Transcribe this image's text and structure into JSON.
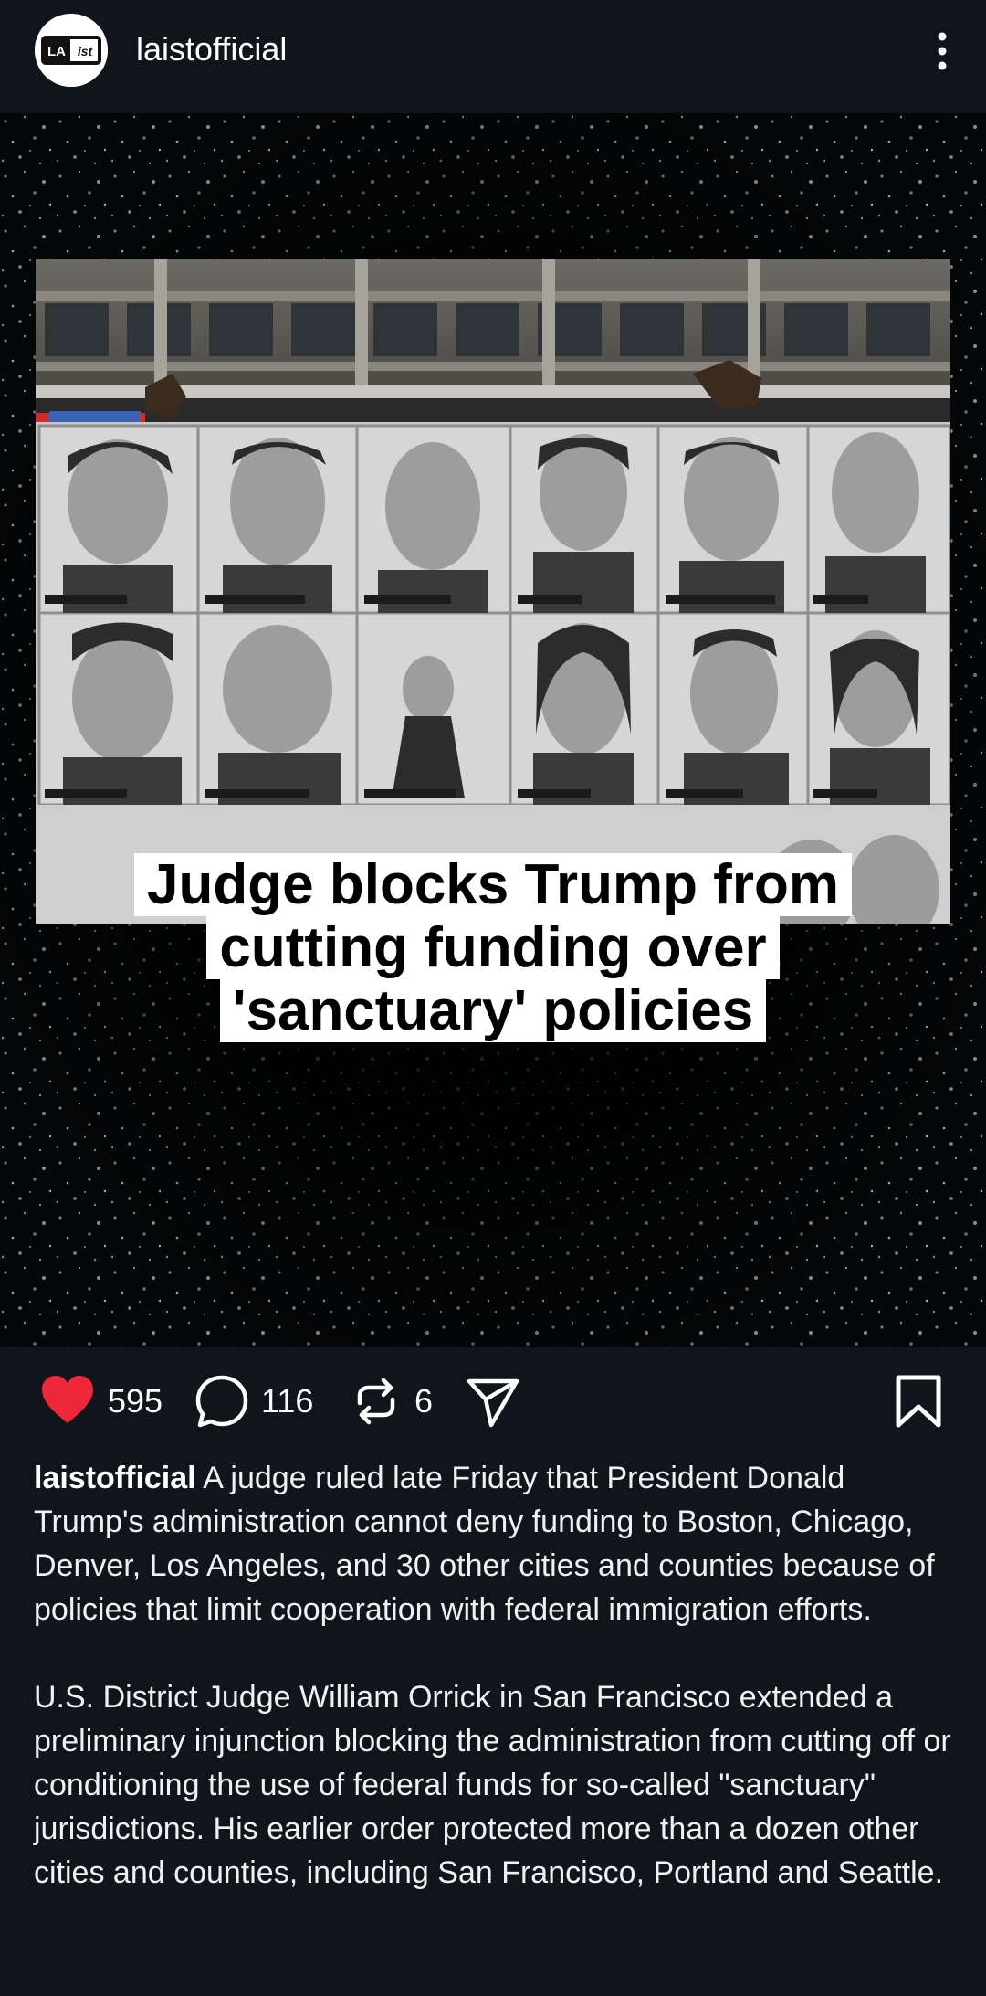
{
  "profile": {
    "username": "laistofficial",
    "avatar_text_left": "LA",
    "avatar_text_right": "ist"
  },
  "header": {
    "more_icon": "more-vertical-icon"
  },
  "post": {
    "headline_lines": [
      "Judge blocks Trump from",
      "cutting funding over",
      "'sanctuary' policies"
    ]
  },
  "actions": {
    "like": {
      "icon": "heart-icon",
      "count": "595",
      "color": "#ed2838"
    },
    "comment": {
      "icon": "comment-icon",
      "count": "116"
    },
    "repost": {
      "icon": "repost-icon",
      "count": "6"
    },
    "share": {
      "icon": "send-icon"
    },
    "save": {
      "icon": "bookmark-icon"
    }
  },
  "caption": {
    "username": "laistofficial",
    "paragraph1": "A judge ruled late Friday that President Donald Trump's administration cannot deny funding to Boston, Chicago, Denver, Los Angeles, and 30 other cities and counties because of policies that limit cooperation with federal immigration efforts.",
    "paragraph2": "U.S. District Judge William Orrick in San Francisco extended a preliminary injunction blocking the administration from cutting off or conditioning the use of federal funds for so-called \"sanctuary\" jurisdictions. His earlier order protected more than a dozen other cities and counties, including San Francisco, Portland and Seattle."
  }
}
